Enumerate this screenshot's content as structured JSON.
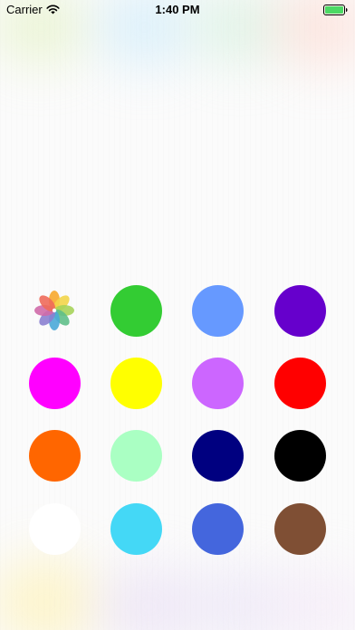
{
  "status_bar": {
    "carrier": "Carrier",
    "time": "1:40 PM",
    "wifi_icon": "wifi-icon",
    "battery_icon": "battery-full-icon"
  },
  "palette": {
    "photos_icon": "photos-flower-icon",
    "colors": [
      "#33CC33",
      "#6699FF",
      "#6600CC",
      "#FF00FF",
      "#FFFF00",
      "#CC66FF",
      "#FF0000",
      "#FF6600",
      "#AAFFC3",
      "#000080",
      "#000000",
      "#FFFFFF",
      "#44D8F6",
      "#4466DD",
      "#7F4F34"
    ]
  },
  "accent": {
    "battery": "#4CD964"
  }
}
